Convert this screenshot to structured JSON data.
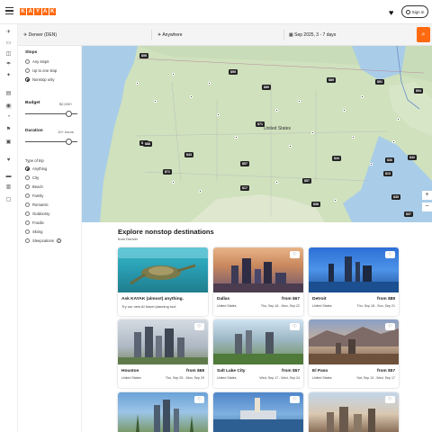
{
  "header": {
    "logo_letters": [
      "K",
      "A",
      "Y",
      "A",
      "K"
    ],
    "signin_label": "Sign in"
  },
  "search": {
    "origin": "Denver (DEN)",
    "destination": "Anywhere",
    "dates": "Sep 2025, 3 - 7 days",
    "go_icon": "search-icon"
  },
  "filters": {
    "stops_title": "Stops",
    "stops_options": [
      "Any stops",
      "Up to one stop",
      "Nonstop only"
    ],
    "budget_title": "Budget",
    "budget_value": "$2,000+",
    "duration_title": "Duration",
    "duration_value": "10+ hours",
    "trip_title": "Type of trip",
    "trip_options": [
      "Anything",
      "City",
      "Beach",
      "Family",
      "Romantic",
      "Outdoorsy",
      "Foodie",
      "Skiing",
      "Sleepcations"
    ]
  },
  "map": {
    "country_label": "United States",
    "pins": [
      "$95",
      "$95",
      "$89",
      "$89",
      "$91",
      "$94",
      "$71",
      "$69",
      "$88",
      "$43",
      "$57",
      "$71",
      "$17",
      "$57",
      "$44",
      "$13",
      "$38",
      "$36",
      "$37",
      "$35",
      "$42"
    ],
    "zoom_in": "+",
    "zoom_out": "−"
  },
  "explore": {
    "title": "Explore nonstop destinations",
    "subtitle": "from Denver",
    "ai_card": {
      "title": "Ask KAYAK (almost) anything.",
      "text": "Try our new AI travel planning tool"
    },
    "cards": [
      {
        "city": "Dallas",
        "price": "from $67",
        "country": "United States",
        "dates": "Thu, Sep 18 - Mon, Sep 22"
      },
      {
        "city": "Detroit",
        "price": "from $88",
        "country": "United States",
        "dates": "Thu, Sep 18 - Sun, Sep 21"
      },
      {
        "city": "Houston",
        "price": "from $68",
        "country": "United States",
        "dates": "Thu, Sep 25 - Mon, Sep 29"
      },
      {
        "city": "Salt Lake City",
        "price": "from $57",
        "country": "United States",
        "dates": "Wed, Sep 17 - Wed, Sep 24"
      },
      {
        "city": "El Paso",
        "price": "from $57",
        "country": "United States",
        "dates": "Sat, Sep 13 - Wed, Sep 17"
      }
    ]
  }
}
